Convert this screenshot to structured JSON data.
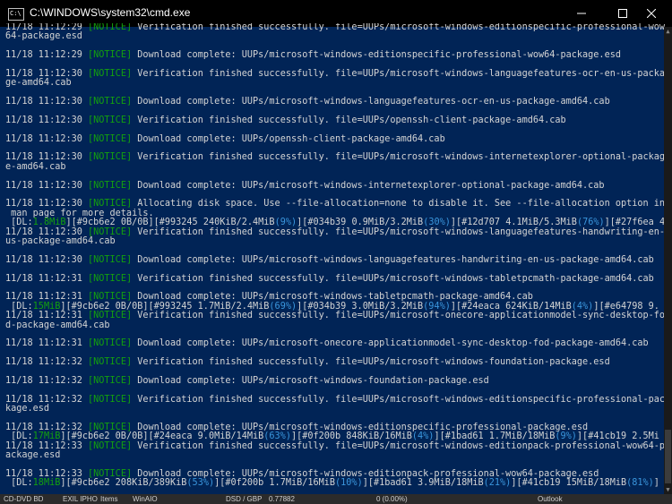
{
  "window": {
    "title": "C:\\WINDOWS\\system32\\cmd.exe",
    "icon_label": "C:\\",
    "controls": {
      "minimize": "minimize-icon",
      "maximize": "maximize-icon",
      "close": "close-icon"
    }
  },
  "colors": {
    "background": "#012456",
    "notice": "#13a10e",
    "progress": "#3a96dd",
    "text": "#d4d4d4"
  },
  "lines": [
    {
      "ts": "11/18 11:12:29",
      "tag": "[NOTICE]",
      "msg": " Verification finished successfully. file=UUPs/microsoft-windows-editionspecific-professional-wow"
    },
    {
      "ts": "",
      "tag": "",
      "msg": "64-package.esd"
    },
    {
      "ts": "",
      "tag": "",
      "msg": ""
    },
    {
      "ts": "11/18 11:12:29",
      "tag": "[NOTICE]",
      "msg": " Download complete: UUPs/microsoft-windows-editionspecific-professional-wow64-package.esd"
    },
    {
      "ts": "",
      "tag": "",
      "msg": ""
    },
    {
      "ts": "11/18 11:12:30",
      "tag": "[NOTICE]",
      "msg": " Verification finished successfully. file=UUPs/microsoft-windows-languagefeatures-ocr-en-us-packa"
    },
    {
      "ts": "",
      "tag": "",
      "msg": "ge-amd64.cab"
    },
    {
      "ts": "",
      "tag": "",
      "msg": ""
    },
    {
      "ts": "11/18 11:12:30",
      "tag": "[NOTICE]",
      "msg": " Download complete: UUPs/microsoft-windows-languagefeatures-ocr-en-us-package-amd64.cab"
    },
    {
      "ts": "",
      "tag": "",
      "msg": ""
    },
    {
      "ts": "11/18 11:12:30",
      "tag": "[NOTICE]",
      "msg": " Verification finished successfully. file=UUPs/openssh-client-package-amd64.cab"
    },
    {
      "ts": "",
      "tag": "",
      "msg": ""
    },
    {
      "ts": "11/18 11:12:30",
      "tag": "[NOTICE]",
      "msg": " Download complete: UUPs/openssh-client-package-amd64.cab"
    },
    {
      "ts": "",
      "tag": "",
      "msg": ""
    },
    {
      "ts": "11/18 11:12:30",
      "tag": "[NOTICE]",
      "msg": " Verification finished successfully. file=UUPs/microsoft-windows-internetexplorer-optional-packag"
    },
    {
      "ts": "",
      "tag": "",
      "msg": "e-amd64.cab"
    },
    {
      "ts": "",
      "tag": "",
      "msg": ""
    },
    {
      "ts": "11/18 11:12:30",
      "tag": "[NOTICE]",
      "msg": " Download complete: UUPs/microsoft-windows-internetexplorer-optional-package-amd64.cab"
    },
    {
      "ts": "",
      "tag": "",
      "msg": ""
    },
    {
      "ts": "11/18 11:12:30",
      "tag": "[NOTICE]",
      "msg": " Allocating disk space. Use --file-allocation=none to disable it. See --file-allocation option in"
    },
    {
      "ts": "",
      "tag": "",
      "msg": " man page for more details."
    },
    {
      "ts": "",
      "tag": "",
      "msg": "",
      "progress": [
        {
          "t": " [DL:",
          "c": "text"
        },
        {
          "t": "1.8MiB",
          "c": "tag"
        },
        {
          "t": "][#9cb6e2 0B/0B][#993245 240KiB/2.4MiB",
          "c": "text"
        },
        {
          "t": "(9%)",
          "c": "pct"
        },
        {
          "t": "][#034b39 0.9MiB/3.2MiB",
          "c": "text"
        },
        {
          "t": "(30%)",
          "c": "pct"
        },
        {
          "t": "][#12d707 4.1MiB/5.3MiB",
          "c": "text"
        },
        {
          "t": "(76%)",
          "c": "pct"
        },
        {
          "t": "][#27f6ea 4",
          "c": "text"
        }
      ]
    },
    {
      "ts": "11/18 11:12:30",
      "tag": "[NOTICE]",
      "msg": " Verification finished successfully. file=UUPs/microsoft-windows-languagefeatures-handwriting-en-"
    },
    {
      "ts": "",
      "tag": "",
      "msg": "us-package-amd64.cab"
    },
    {
      "ts": "",
      "tag": "",
      "msg": ""
    },
    {
      "ts": "11/18 11:12:30",
      "tag": "[NOTICE]",
      "msg": " Download complete: UUPs/microsoft-windows-languagefeatures-handwriting-en-us-package-amd64.cab"
    },
    {
      "ts": "",
      "tag": "",
      "msg": ""
    },
    {
      "ts": "11/18 11:12:31",
      "tag": "[NOTICE]",
      "msg": " Verification finished successfully. file=UUPs/microsoft-windows-tabletpcmath-package-amd64.cab"
    },
    {
      "ts": "",
      "tag": "",
      "msg": ""
    },
    {
      "ts": "11/18 11:12:31",
      "tag": "[NOTICE]",
      "msg": " Download complete: UUPs/microsoft-windows-tabletpcmath-package-amd64.cab"
    },
    {
      "ts": "",
      "tag": "",
      "msg": "",
      "progress": [
        {
          "t": " [DL:",
          "c": "text"
        },
        {
          "t": "15MiB",
          "c": "tag"
        },
        {
          "t": "][#9cb6e2 0B/0B][#993245 1.7MiB/2.4MiB",
          "c": "text"
        },
        {
          "t": "(69%)",
          "c": "pct"
        },
        {
          "t": "][#034b39 3.0MiB/3.2MiB",
          "c": "text"
        },
        {
          "t": "(94%)",
          "c": "pct"
        },
        {
          "t": "][#24eaca 624KiB/14MiB",
          "c": "text"
        },
        {
          "t": "(4%)",
          "c": "pct"
        },
        {
          "t": "][#e64798 9.",
          "c": "text"
        }
      ]
    },
    {
      "ts": "11/18 11:12:31",
      "tag": "[NOTICE]",
      "msg": " Verification finished successfully. file=UUPs/microsoft-onecore-applicationmodel-sync-desktop-fo"
    },
    {
      "ts": "",
      "tag": "",
      "msg": "d-package-amd64.cab"
    },
    {
      "ts": "",
      "tag": "",
      "msg": ""
    },
    {
      "ts": "11/18 11:12:31",
      "tag": "[NOTICE]",
      "msg": " Download complete: UUPs/microsoft-onecore-applicationmodel-sync-desktop-fod-package-amd64.cab"
    },
    {
      "ts": "",
      "tag": "",
      "msg": ""
    },
    {
      "ts": "11/18 11:12:32",
      "tag": "[NOTICE]",
      "msg": " Verification finished successfully. file=UUPs/microsoft-windows-foundation-package.esd"
    },
    {
      "ts": "",
      "tag": "",
      "msg": ""
    },
    {
      "ts": "11/18 11:12:32",
      "tag": "[NOTICE]",
      "msg": " Download complete: UUPs/microsoft-windows-foundation-package.esd"
    },
    {
      "ts": "",
      "tag": "",
      "msg": ""
    },
    {
      "ts": "11/18 11:12:32",
      "tag": "[NOTICE]",
      "msg": " Verification finished successfully. file=UUPs/microsoft-windows-editionspecific-professional-pac"
    },
    {
      "ts": "",
      "tag": "",
      "msg": "kage.esd"
    },
    {
      "ts": "",
      "tag": "",
      "msg": ""
    },
    {
      "ts": "11/18 11:12:32",
      "tag": "[NOTICE]",
      "msg": " Download complete: UUPs/microsoft-windows-editionspecific-professional-package.esd"
    },
    {
      "ts": "",
      "tag": "",
      "msg": "",
      "progress": [
        {
          "t": " [DL:",
          "c": "text"
        },
        {
          "t": "17MiB",
          "c": "tag"
        },
        {
          "t": "][#9cb6e2 0B/0B][#24eaca 9.0MiB/14MiB",
          "c": "text"
        },
        {
          "t": "(63%)",
          "c": "pct"
        },
        {
          "t": "][#0f200b 848KiB/16MiB",
          "c": "text"
        },
        {
          "t": "(4%)",
          "c": "pct"
        },
        {
          "t": "][#1bad61 1.7MiB/18MiB",
          "c": "text"
        },
        {
          "t": "(9%)",
          "c": "pct"
        },
        {
          "t": "][#41cb19 2.5Mi",
          "c": "text"
        }
      ]
    },
    {
      "ts": "11/18 11:12:33",
      "tag": "[NOTICE]",
      "msg": " Verification finished successfully. file=UUPs/microsoft-windows-editionpack-professional-wow64-p"
    },
    {
      "ts": "",
      "tag": "",
      "msg": "ackage.esd"
    },
    {
      "ts": "",
      "tag": "",
      "msg": ""
    },
    {
      "ts": "11/18 11:12:33",
      "tag": "[NOTICE]",
      "msg": " Download complete: UUPs/microsoft-windows-editionpack-professional-wow64-package.esd"
    },
    {
      "ts": "",
      "tag": "",
      "msg": "",
      "progress": [
        {
          "t": " [DL:",
          "c": "text"
        },
        {
          "t": "18MiB",
          "c": "tag"
        },
        {
          "t": "][#9cb6e2 208KiB/389KiB",
          "c": "text"
        },
        {
          "t": "(53%)",
          "c": "pct"
        },
        {
          "t": "][#0f200b 1.7MiB/16MiB",
          "c": "text"
        },
        {
          "t": "(10%)",
          "c": "pct"
        },
        {
          "t": "][#1bad61 3.9MiB/18MiB",
          "c": "text"
        },
        {
          "t": "(21%)",
          "c": "pct"
        },
        {
          "t": "][#41cb19 15MiB/18MiB",
          "c": "text"
        },
        {
          "t": "(81%)",
          "c": "pct"
        },
        {
          "t": "]",
          "c": "text"
        }
      ]
    }
  ],
  "taskbar": {
    "items": [
      "CD-DVD BD",
      "EXIL IPHO",
      "Items",
      "WinAIO",
      "DSD / GBP",
      "0.77882",
      "0 (0.00%)",
      "Outlook"
    ]
  }
}
